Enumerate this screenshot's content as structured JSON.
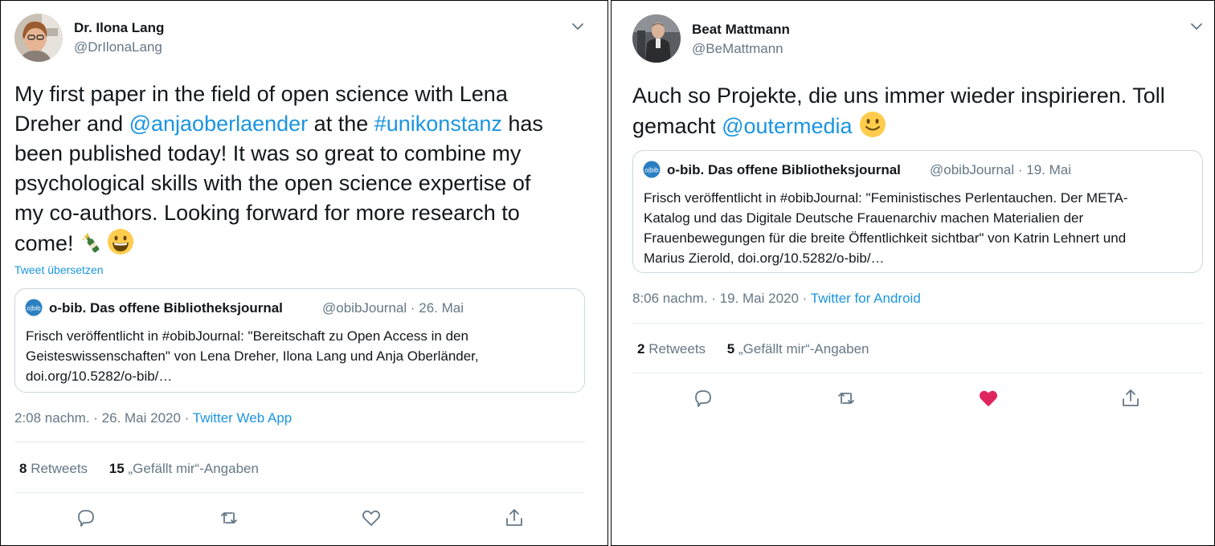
{
  "left": {
    "author_name": "Dr. Ilona Lang",
    "author_handle": "@DrIlonaLang",
    "text_l1": "My first paper in the field of open science with Lena",
    "text_l2_a": "Dreher and ",
    "text_l2_mention": "@anjaoberlaender",
    "text_l2_b": " at the ",
    "text_l2_hashtag": "#unikonstanz",
    "text_l2_c": " has",
    "text_l3": "been published today! It was so great to combine my",
    "text_l4": "psychological skills with the open science expertise of",
    "text_l5": "my co-authors. Looking forward for more research to",
    "text_l6": "come! ",
    "translate_label": "Tweet übersetzen",
    "quote": {
      "name": "o-bib. Das offene Bibliotheksjournal",
      "meta": "@obibJournal · 26. Mai",
      "line1": "Frisch veröffentlicht in #obibJournal: \"Bereitschaft zu Open Access in den",
      "line2": "Geisteswissenschaften\" von Lena Dreher, Ilona Lang und Anja Oberländer,",
      "line3": "doi.org/10.5282/o-bib/…"
    },
    "timestamp": "2:08 nachm. · 26. Mai 2020 · ",
    "source": "Twitter Web App",
    "retweets_count": "8",
    "retweets_label": " Retweets",
    "likes_count": "15",
    "likes_label": " „Gefällt mir“-Angaben",
    "liked": false
  },
  "right": {
    "author_name": "Beat Mattmann",
    "author_handle": "@BeMattmann",
    "text_l1": "Auch so Projekte, die uns immer wieder inspirieren. Toll",
    "text_l2_a": "gemacht ",
    "text_l2_mention": "@outermedia",
    "quote": {
      "name": "o-bib. Das offene Bibliotheksjournal",
      "meta": "@obibJournal · 19. Mai",
      "line1": "Frisch veröffentlicht in #obibJournal: \"Feministisches Perlentauchen. Der META-",
      "line2": "Katalog und das Digitale Deutsche Frauenarchiv machen Materialien der",
      "line3": "Frauenbewegungen für die breite Öffentlichkeit sichtbar\" von Katrin Lehnert und",
      "line4": "Marius Zierold, doi.org/10.5282/o-bib/…"
    },
    "timestamp": "8:06 nachm. · 19. Mai 2020 · ",
    "source": "Twitter for Android",
    "retweets_count": "2",
    "retweets_label": " Retweets",
    "likes_count": "5",
    "likes_label": " „Gefällt mir“-Angaben",
    "liked": true
  },
  "icons": {
    "reply": "reply-icon",
    "retweet": "retweet-icon",
    "like": "heart-icon",
    "share": "share-icon",
    "caret": "chevron-down-icon"
  },
  "colors": {
    "link": "#1b95e0",
    "liked_heart": "#e0245e",
    "muted": "#657786",
    "border": "#ccd6dd",
    "obib_logo": "#2a7fc1"
  }
}
